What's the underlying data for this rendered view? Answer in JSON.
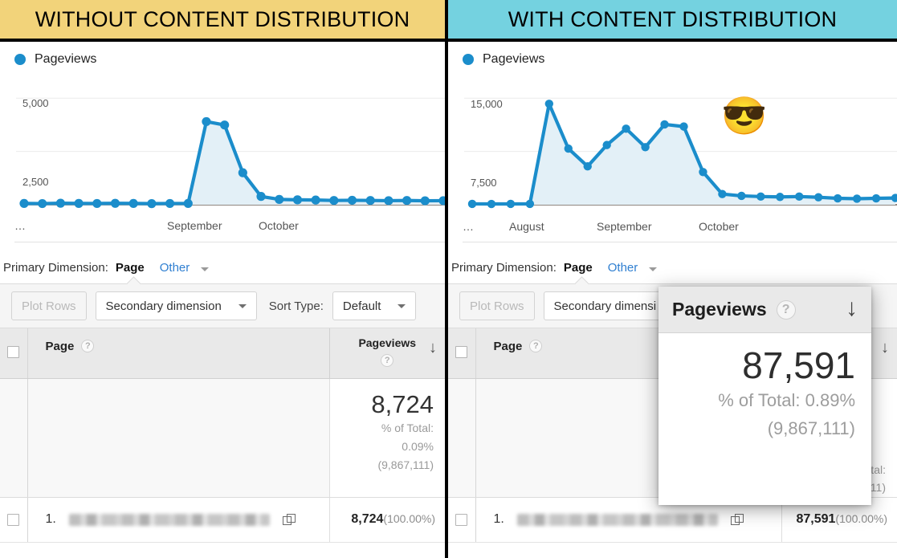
{
  "banners": {
    "left": "WITHOUT CONTENT DISTRIBUTION",
    "right": "WITH CONTENT DISTRIBUTION"
  },
  "legend": {
    "label": "Pageviews"
  },
  "primary_dimension": {
    "label": "Primary Dimension:",
    "value": "Page",
    "other": "Other"
  },
  "toolbar": {
    "plot_rows": "Plot Rows",
    "secondary_dimension": "Secondary dimension",
    "secondary_dimension_truncated": "Secondary dimensi",
    "sort_type_label": "Sort Type:",
    "sort_type_value": "Default"
  },
  "table": {
    "header_page": "Page",
    "header_views": "Pageviews",
    "help_glyph": "?",
    "sort_glyph": "↓"
  },
  "left_panel": {
    "total_value": "8,724",
    "total_pct_label": "% of Total:",
    "total_pct": "0.09%",
    "total_base": "(9,867,111)",
    "row_index": "1.",
    "row_value": "8,724",
    "row_pct": "(100.00%)"
  },
  "right_panel": {
    "total_value": "87,591",
    "total_pct_label": "% of Total:",
    "total_pct": "0.89%",
    "total_base": "(9,867,111)",
    "row_index": "1.",
    "row_value": "87,591",
    "row_pct": "(100.00%)"
  },
  "popup": {
    "title": "Pageviews",
    "help_glyph": "?",
    "sort_glyph": "↓",
    "value": "87,591",
    "pct_line": "% of Total: 0.89%",
    "base_line": "(9,867,111)"
  },
  "emoji": {
    "glyph": "😎",
    "name": "smoking-sunglasses-face"
  },
  "colors": {
    "banner_left": "#f2d37a",
    "banner_right": "#74d2e0",
    "series": "#1b8dcb",
    "series_fill": "#e3f0f7",
    "link": "#2f7fd1"
  },
  "chart_data": [
    {
      "id": "left",
      "type": "area",
      "title": "WITHOUT CONTENT DISTRIBUTION",
      "series_name": "Pageviews",
      "xlabel": "",
      "ylabel": "",
      "ylim": [
        0,
        6250
      ],
      "yticks": [
        2500,
        5000
      ],
      "ytick_labels": [
        "2,500",
        "5,000"
      ],
      "xtick_labels": [
        "…",
        "September",
        "October"
      ],
      "grid": true,
      "legend": "top-left",
      "values": [
        60,
        55,
        70,
        62,
        58,
        66,
        60,
        52,
        58,
        60,
        3900,
        3740,
        1500,
        390,
        250,
        230,
        220,
        200,
        210,
        200,
        190,
        200,
        185,
        190
      ]
    },
    {
      "id": "right",
      "type": "area",
      "title": "WITH CONTENT DISTRIBUTION",
      "series_name": "Pageviews",
      "xlabel": "",
      "ylabel": "",
      "ylim": [
        0,
        18750
      ],
      "yticks": [
        7500,
        15000
      ],
      "ytick_labels": [
        "7,500",
        "15,000"
      ],
      "xtick_labels": [
        "…",
        "August",
        "September",
        "October"
      ],
      "grid": true,
      "legend": "top-left",
      "values": [
        120,
        110,
        115,
        120,
        14200,
        7900,
        5400,
        8400,
        10700,
        8100,
        11300,
        11000,
        4600,
        1500,
        1250,
        1150,
        1100,
        1150,
        1050,
        900,
        850,
        900,
        950
      ]
    }
  ]
}
